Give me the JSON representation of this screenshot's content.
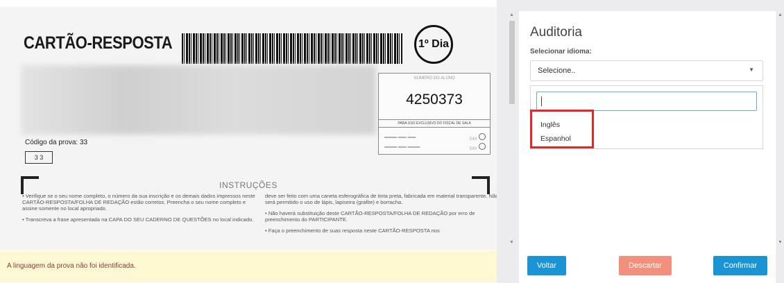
{
  "document": {
    "title": "CARTÃO-RESPOSTA",
    "day_label": "1º Dia",
    "participant_number": "4250373",
    "number_box_header": "NÚMERO DO ALUNO",
    "proctor_header": "PARA USO EXCLUSIVO DO FISCAL DE SALA",
    "check_1": "SIM",
    "check_2": "SIM",
    "test_code_label": "Código da prova:",
    "test_code_value": "33",
    "code_boxes": "3 3",
    "instructions_title": "INSTRUÇÕES",
    "instructions_left": [
      "• Verifique se o seu nome completo, o número da sua inscrição e os demais dados impressos neste CARTÃO-RESPOSTA/FOLHA DE REDAÇÃO estão corretos. Preencha o seu nome completo e assine somente no local apropriado.",
      "• Transcreva a frase apresentada na CAPA DO SEU CADERNO DE QUESTÕES no local indicado."
    ],
    "instructions_right": [
      "deve ser feito com uma caneta esferográfica de tinta preta, fabricada em material transparente. Não será permitido o uso de lápis, lapiseira (grafite) e borracha.",
      "• Não haverá substituição deste CARTÃO-RESPOSTA/FOLHA DE REDAÇÃO por erro de preenchimento do PARTICIPANTE.",
      "• Faça o preenchimento de suas resposta neste CARTÃO-RESPOSTA nos"
    ]
  },
  "warning": {
    "text": "A linguagem da prova não foi identificada."
  },
  "audit": {
    "title": "Auditoria",
    "language_label": "Selecionar idioma:",
    "select_value": "Selecione..",
    "search_value": "",
    "options": [
      "Inglês",
      "Espanhol"
    ]
  },
  "buttons": {
    "back": "Voltar",
    "discard": "Descartar",
    "confirm": "Confirmar"
  },
  "colors": {
    "primary": "#1a94d4",
    "discard": "#f2907c",
    "warning_bg": "#fcf8d2",
    "highlight": "#e0282a"
  }
}
